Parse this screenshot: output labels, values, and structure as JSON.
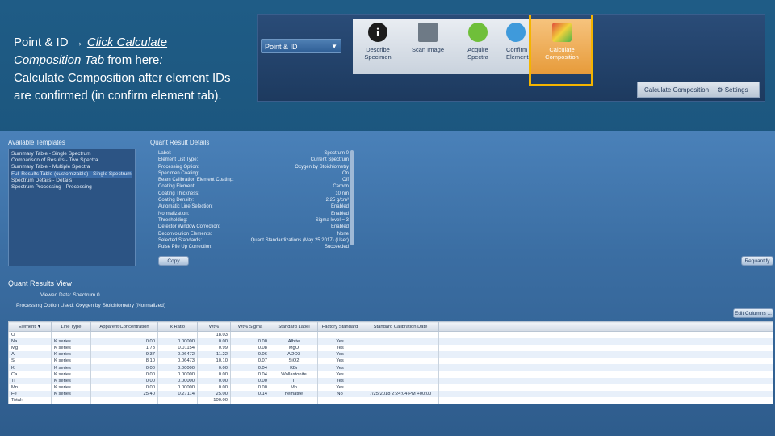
{
  "caption": {
    "line1_prefix": "Point & ID ",
    "arrow": "→",
    "line1_link": "Click Calculate",
    "line2_link": "Composition Tab ",
    "line2_rest": "from here",
    "line2_colon": ":",
    "body": "Calculate Composition after element IDs are confirmed (in confirm element tab)."
  },
  "toolbar": {
    "dropdown_value": "Point & ID",
    "steps": [
      {
        "label": "Describe\nSpecimen",
        "icon": "info-icon"
      },
      {
        "label": "Scan Image",
        "icon": "scan-image-icon"
      },
      {
        "label": "Acquire\nSpectra",
        "icon": "acquire-spectra-icon"
      },
      {
        "label": "Confirm\nElements",
        "icon": "confirm-elements-icon"
      },
      {
        "label": "Calculate\nComposition",
        "icon": "calculate-composition-icon"
      }
    ],
    "subbar_label": "Calculate Composition",
    "settings_label": "Settings"
  },
  "templates": {
    "title": "Available Templates",
    "items": [
      "Summary Table - Single Spectrum",
      "Comparison of Results - Two Spectra",
      "Summary Table - Multiple Spectra",
      "Full Results Table (customizable) - Single Spectrum",
      "Spectrum Details - Details",
      "Spectrum Processing - Processing"
    ],
    "selected_index": 3
  },
  "details": {
    "title": "Quant Result Details",
    "rows": [
      [
        "Label:",
        "Spectrum 0"
      ],
      [
        "Element List Type:",
        "Current Spectrum"
      ],
      [
        "Processing Option:",
        "Oxygen by Stoichiometry"
      ],
      [
        "Specimen Coating:",
        "On"
      ],
      [
        "Beam Calibration Element Coating:",
        "Off"
      ],
      [
        "Coating Element:",
        "Carbon"
      ],
      [
        "Coating Thickness:",
        "10 nm"
      ],
      [
        "Coating Density:",
        "2.25 g/cm³"
      ],
      [
        "Automatic Line Selection:",
        "Enabled"
      ],
      [
        "Normalization:",
        "Enabled"
      ],
      [
        "Thresholding:",
        "Sigma level = 3"
      ],
      [
        "Detector Window Correction:",
        "Enabled"
      ],
      [
        "Deconvolution Elements:",
        "None"
      ],
      [
        "Selected Standards:",
        "Quant Standardizations (May 25 2017) (User)"
      ],
      [
        "Pulse Pile Up Correction:",
        "Succeeded"
      ]
    ],
    "copy_label": "Copy",
    "requantify_label": "Requantify"
  },
  "qrv": {
    "title": "Quant Results View",
    "viewed_data_label": "Viewed Data:",
    "viewed_data_value": "Spectrum 0",
    "processing_label": "Processing Option Used:",
    "processing_value": "Oxygen by Stoichiometry (Normalized)",
    "edit_columns_label": "Edit Columns ..."
  },
  "table": {
    "headers": [
      "Element ▼",
      "Line Type",
      "Apparent Concentration",
      "k Ratio",
      "Wt%",
      "Wt% Sigma",
      "Standard Label",
      "Factory Standard",
      "Standard Calibration Date"
    ],
    "rows": [
      [
        "O",
        "",
        "",
        "",
        "18.03",
        "",
        "",
        "",
        ""
      ],
      [
        "Na",
        "K series",
        "0.00",
        "0.00000",
        "0.00",
        "0.00",
        "Albite",
        "Yes",
        ""
      ],
      [
        "Mg",
        "K series",
        "1.73",
        "0.01154",
        "0.99",
        "0.08",
        "MgO",
        "Yes",
        ""
      ],
      [
        "Al",
        "K series",
        "9.37",
        "0.06472",
        "11.22",
        "0.06",
        "Al2O3",
        "Yes",
        ""
      ],
      [
        "Si",
        "K series",
        "8.10",
        "0.06473",
        "10.10",
        "0.07",
        "SiO2",
        "Yes",
        ""
      ],
      [
        "K",
        "K series",
        "0.00",
        "0.00000",
        "0.00",
        "0.04",
        "KBr",
        "Yes",
        ""
      ],
      [
        "Ca",
        "K series",
        "0.00",
        "0.00000",
        "0.00",
        "0.04",
        "Wollastonite",
        "Yes",
        ""
      ],
      [
        "Ti",
        "K series",
        "0.00",
        "0.00000",
        "0.00",
        "0.00",
        "Ti",
        "Yes",
        ""
      ],
      [
        "Mn",
        "K series",
        "0.00",
        "0.00000",
        "0.00",
        "0.00",
        "Mn",
        "Yes",
        ""
      ],
      [
        "Fe",
        "K series",
        "25.40",
        "0.27114",
        "25.00",
        "0.14",
        "hematite",
        "No",
        "7/25/2018 2:24:04 PM +00:00"
      ],
      [
        "Total:",
        "",
        "",
        "",
        "100.00",
        "",
        "",
        "",
        ""
      ]
    ]
  },
  "colors": {
    "highlight": "#f4b400",
    "background": "#1f5c86"
  }
}
